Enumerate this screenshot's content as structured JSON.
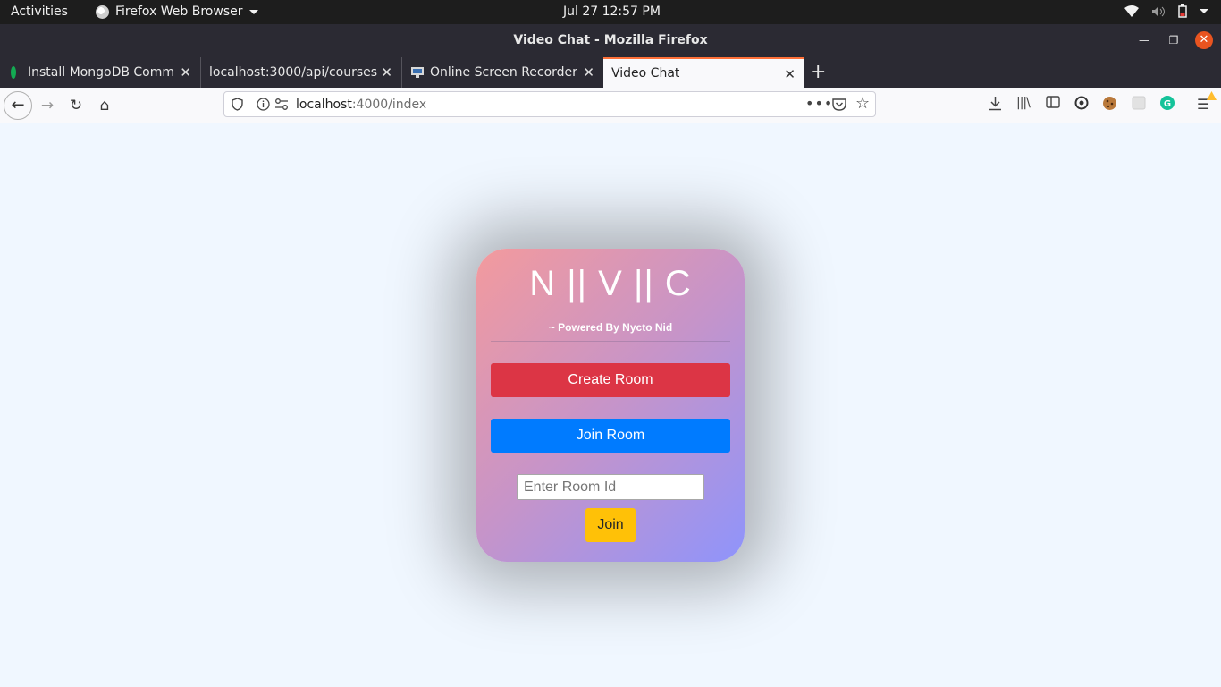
{
  "system_bar": {
    "activities": "Activities",
    "app_name": "Firefox Web Browser",
    "clock": "Jul 27  12:57 PM"
  },
  "window": {
    "title": "Video Chat - Mozilla Firefox"
  },
  "tabs": [
    {
      "label": "Install MongoDB Commu",
      "icon": "mongodb-leaf-icon"
    },
    {
      "label": "localhost:3000/api/courses",
      "icon": ""
    },
    {
      "label": "Online Screen Recorder",
      "icon": "monitor-icon"
    },
    {
      "label": "Video Chat",
      "icon": "",
      "active": true
    }
  ],
  "url": {
    "host": "localhost",
    "path": ":4000/index"
  },
  "page": {
    "brand": "N || V || C",
    "powered_by": "~ Powered By Nycto Nid",
    "create_room": "Create Room",
    "join_room": "Join Room",
    "room_id_placeholder": "Enter Room Id",
    "join": "Join"
  },
  "colors": {
    "create_button": "#dc3545",
    "join_room_button": "#007bff",
    "join_button": "#ffc107",
    "card_gradient_start": "#f39a9d",
    "card_gradient_end": "#8f94fb",
    "page_background": "#f0f7ff"
  }
}
